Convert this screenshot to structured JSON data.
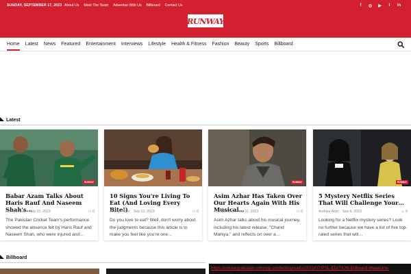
{
  "topbar": {
    "date": "SUNDAY, SEPTEMBER 17, 2023",
    "links": [
      "About Us",
      "Meet The Team",
      "Advertise With Us",
      "Billboard",
      "Contact Us"
    ],
    "socials": [
      {
        "icon": "facebook-icon",
        "glyph": "f"
      },
      {
        "icon": "instagram-icon",
        "glyph": "◎"
      },
      {
        "icon": "youtube-icon",
        "glyph": "▶"
      },
      {
        "icon": "twitter-icon",
        "glyph": "t"
      },
      {
        "icon": "linkedin-icon",
        "glyph": "in"
      }
    ]
  },
  "brand": {
    "logo_text": "RUNWAY",
    "accent_color": "#d22030"
  },
  "nav": {
    "items": [
      "Home",
      "Latest",
      "News",
      "Featured",
      "Entertainment",
      "Interviews",
      "Lifestyle",
      "Health & Fitness",
      "Fashion",
      "Beauty",
      "Sports",
      "Billboard"
    ],
    "active_index": 0,
    "search_icon": "search-icon"
  },
  "sections": {
    "latest": "Latest",
    "billboard": "Billboard"
  },
  "cards": [
    {
      "title": "Babar Azam Talks About Haris Rauf And Naseem Shah's…",
      "author": "Arshiya Abid",
      "date": "Sep 15, 2023",
      "comments": "0",
      "excerpt": "The Pakistan Cricket Team's performance showed the absence felt by Haris Rauf and Naseem Shah, who were injured and…",
      "badge": "RUNWAY"
    },
    {
      "title": "10 Signs You're Living To Eat (And Loving Every Bite!)",
      "author": "Arshiya Abid",
      "date": "Sep 12, 2023",
      "comments": "0",
      "excerpt": "Do you love to eat? Well, don't worry about the judgments because this article is to make you feel like you're one…",
      "badge": ""
    },
    {
      "title": "Asim Azhar Has Taken Over Our Hearts Again With His Musical…",
      "author": "Arshiya Abid",
      "date": "Sep 11, 2023",
      "comments": "0",
      "excerpt": "Asim Azhar talks about his musical journey, including his latest release, \"Chand Mahiya,\" and reflects on over a…",
      "badge": "RUNWAY"
    },
    {
      "title": "5 Mystery Netflix Series That Will Challenge Your…",
      "author": "Arshiya Abid",
      "date": "Sep 6, 2023",
      "comments": "0",
      "excerpt": "Looking for a Netflix mystery series? Look no further because we have a list of five top-rated series that will…",
      "badge": "RUNWAY"
    }
  ],
  "billboard": {
    "url_text": "https://runwaypakistan.com/wp-content/uploads/2021/07/PSL-EDITION-Billboard-Magazine-"
  }
}
